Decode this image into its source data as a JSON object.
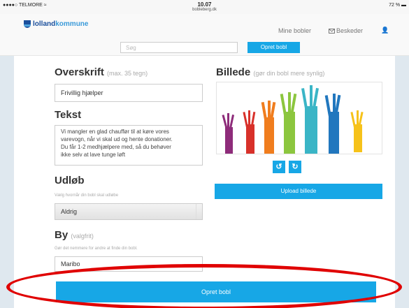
{
  "status_bar": {
    "carrier": "●●●●○ TELMORE ≈",
    "time": "10.07",
    "url": "bobleberg.dk",
    "battery": "72 % ▬"
  },
  "header": {
    "logo_part1": "lolland",
    "logo_part2": "kommune",
    "nav_my_bubbles": "Mine bobler",
    "nav_messages": "Beskeder",
    "nav_user_icon": "👤"
  },
  "search": {
    "placeholder": "Søg",
    "create_button": "Opret bobl"
  },
  "form": {
    "headline_label": "Overskrift",
    "headline_hint": "(max. 35 tegn)",
    "headline_value": "Frivillig hjælper",
    "text_label": "Tekst",
    "text_lines": [
      "Vi mangler en glad chauffør til at køre vores",
      "varevogn, når vi skal ud og hente donationer.",
      "Du får 1-2 medhjælpere med, så du behøver",
      "ikke selv at lave tunge løft"
    ],
    "expiry_label": "Udløb",
    "expiry_hint": "Vælg hvornår din bobl skal udløbe",
    "expiry_value": "Aldrig",
    "city_label": "By",
    "city_hint_suffix": "(valgfrit)",
    "city_hint": "Gør det nemmere for andre at finde din bobl.",
    "city_value": "Maribo",
    "image_label": "Billede",
    "image_hint": "(gør din bobl mere synlig)",
    "rotate_left_symbol": "↺",
    "rotate_right_symbol": "↻",
    "upload_button": "Upload billede",
    "submit_button": "Opret bobl"
  },
  "colors": {
    "accent": "#17a7e6",
    "highlight": "#e00000",
    "background": "#dfe8ef"
  },
  "icons": {
    "rotate_left": "rotate-left-icon",
    "rotate_right": "rotate-right-icon",
    "messages": "envelope-icon",
    "user": "user-icon"
  }
}
